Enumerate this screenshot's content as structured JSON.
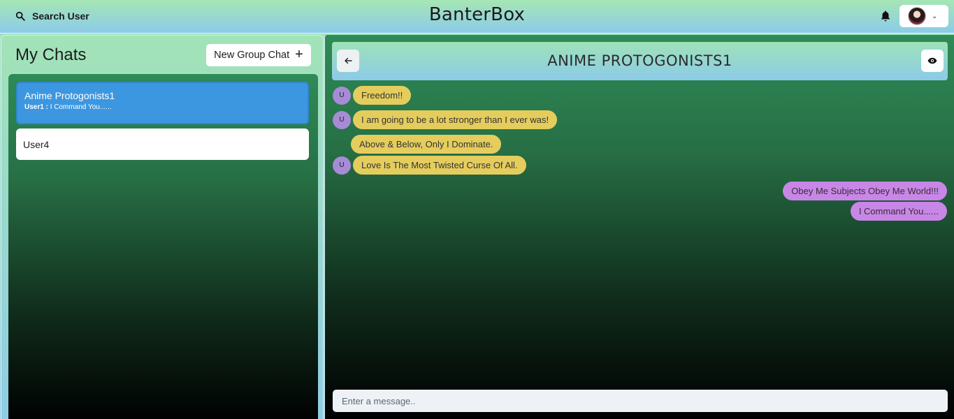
{
  "topbar": {
    "search_label": "Search User",
    "brand": "BanterBox",
    "icons": {
      "search": "search-icon",
      "bell": "bell-icon",
      "chevron": "chevron-down-icon"
    }
  },
  "sidebar": {
    "title": "My Chats",
    "new_group_label": "New Group Chat",
    "chats": [
      {
        "name": "Anime Protogonists1",
        "last_sender": "User1 :",
        "last_message": "I Command You......",
        "active": true
      },
      {
        "name": "User4",
        "active": false
      }
    ]
  },
  "chat": {
    "title": "ANIME PROTOGONISTS1",
    "messages": [
      {
        "avatar": "U",
        "text": "Freedom!!",
        "side": "in"
      },
      {
        "avatar": "U",
        "text": "I am going to be a lot stronger than I ever was!",
        "side": "in"
      },
      {
        "avatar": "",
        "text": "Above & Below, Only I Dominate.",
        "side": "in"
      },
      {
        "avatar": "U",
        "text": "Love Is The Most Twisted Curse Of All.",
        "side": "in"
      },
      {
        "text": "Obey Me Subjects Obey Me World!!!",
        "side": "out"
      },
      {
        "text": "I Command You......",
        "side": "out"
      }
    ],
    "input_placeholder": "Enter a message.."
  },
  "colors": {
    "active_chat": "#3d97e0",
    "incoming_bubble": "#e5cd5d",
    "outgoing_bubble": "#c887e6",
    "avatar_bg": "#a78bd6"
  }
}
